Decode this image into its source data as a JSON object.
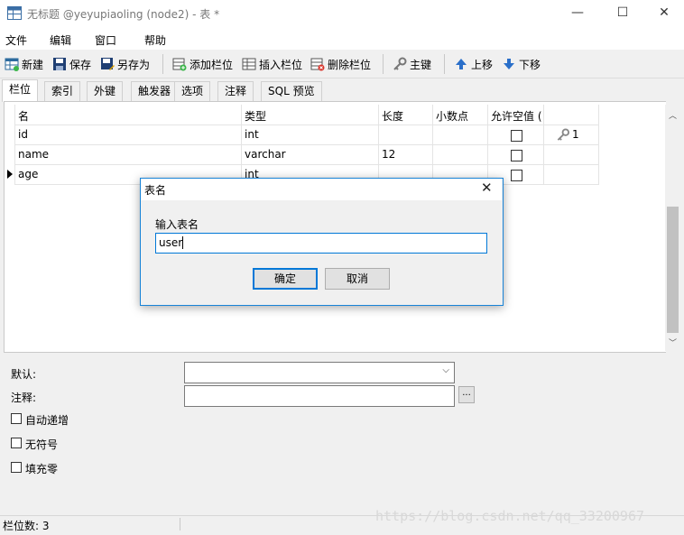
{
  "window": {
    "title": "无标题 @yeyupiaoling (node2) - 表 *",
    "minimize": "—",
    "maximize": "☐",
    "close": "✕"
  },
  "menu": [
    "文件",
    "编辑",
    "窗口",
    "帮助"
  ],
  "toolbar": {
    "new": "新建",
    "save": "保存",
    "save_as": "另存为",
    "add_field": "添加栏位",
    "insert_field": "插入栏位",
    "delete_field": "删除栏位",
    "primary_key": "主键",
    "move_up": "上移",
    "move_down": "下移"
  },
  "tabs": [
    "栏位",
    "索引",
    "外键",
    "触发器",
    "选项",
    "注释",
    "SQL 预览"
  ],
  "grid": {
    "headers": [
      "名",
      "类型",
      "长度",
      "小数点",
      "允许空值 ("
    ],
    "rows": [
      {
        "name": "id",
        "type": "int",
        "length": "",
        "decimals": "",
        "nullable": false,
        "key": "1"
      },
      {
        "name": "name",
        "type": "varchar",
        "length": "12",
        "decimals": "",
        "nullable": false,
        "key": ""
      },
      {
        "name": "age",
        "type": "int",
        "length": "",
        "decimals": "",
        "nullable": false,
        "key": ""
      }
    ]
  },
  "props": {
    "default_label": "默认:",
    "comment_label": "注释:",
    "comment_button": "...",
    "auto_increment": "自动递增",
    "unsigned": "无符号",
    "zerofill": "填充零"
  },
  "status": {
    "field_count": "栏位数: 3"
  },
  "dialog": {
    "title": "表名",
    "prompt": "输入表名",
    "value": "user",
    "ok": "确定",
    "cancel": "取消"
  },
  "watermark": "https://blog.csdn.net/qq_33200967",
  "colors": {
    "accent": "#0078d7",
    "dialog_border": "#1883d7"
  }
}
